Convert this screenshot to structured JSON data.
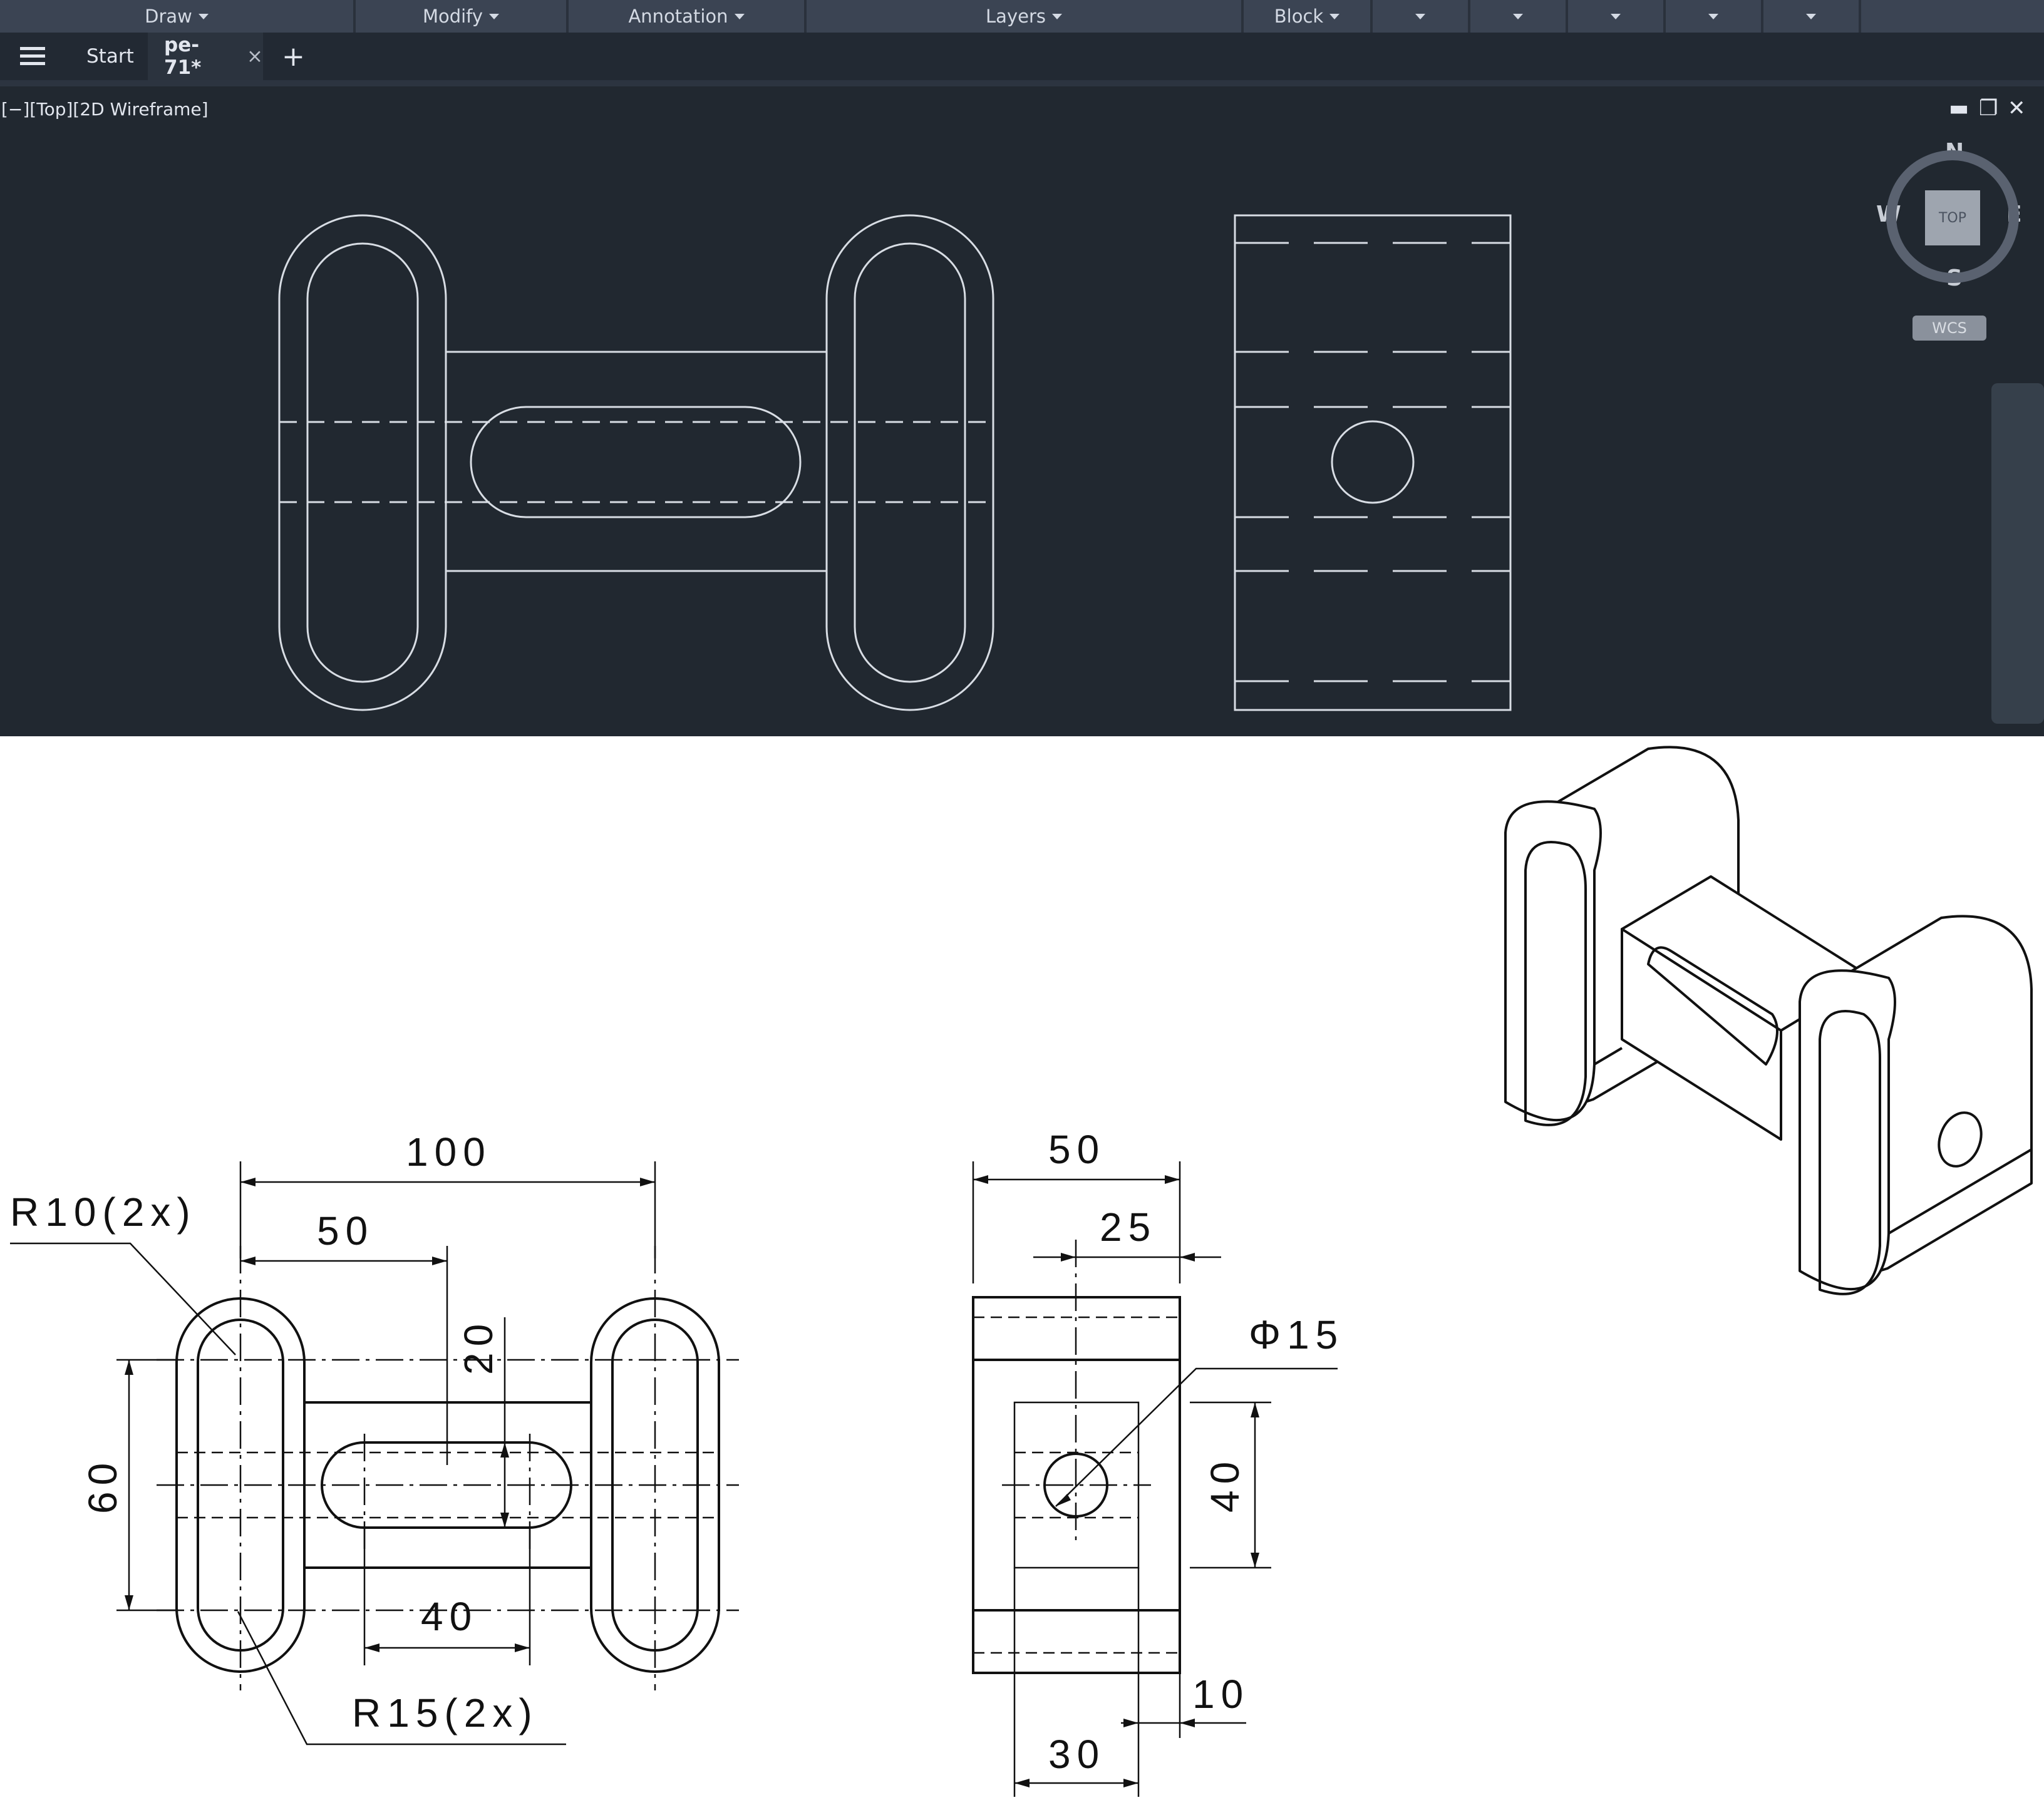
{
  "ribbon": {
    "panels": [
      {
        "label": "Draw"
      },
      {
        "label": "Modify"
      },
      {
        "label": "Annotation"
      },
      {
        "label": "Layers"
      },
      {
        "label": "Block"
      },
      {
        "label": ""
      },
      {
        "label": ""
      },
      {
        "label": ""
      },
      {
        "label": ""
      },
      {
        "label": ""
      }
    ]
  },
  "tabs": {
    "start_label": "Start",
    "active_label": "pe-71*",
    "close_glyph": "×",
    "new_glyph": "+"
  },
  "viewport": {
    "label": "[−][Top][2D Wireframe]",
    "minimize_glyph": "▬",
    "restore_glyph": "❐",
    "close_glyph": "✕"
  },
  "viewcube": {
    "face": "TOP",
    "north": "N",
    "south": "S",
    "east": "E",
    "west": "W",
    "wcs": "WCS"
  },
  "colors": {
    "ribbon_bg": "#3b4453",
    "viewport_bg": "#212830",
    "linework": "#d8dde4",
    "paper_ink": "#111111"
  },
  "drawing": {
    "dims": {
      "d100": "100",
      "d50_top": "50",
      "d20": "20",
      "d60": "60",
      "d40_slot": "40",
      "r10": "R10(2x)",
      "r15": "R15(2x)",
      "d50_side": "50",
      "d25": "25",
      "phi15": "Φ15",
      "d40_side": "40",
      "d10": "10",
      "d30": "30"
    }
  }
}
